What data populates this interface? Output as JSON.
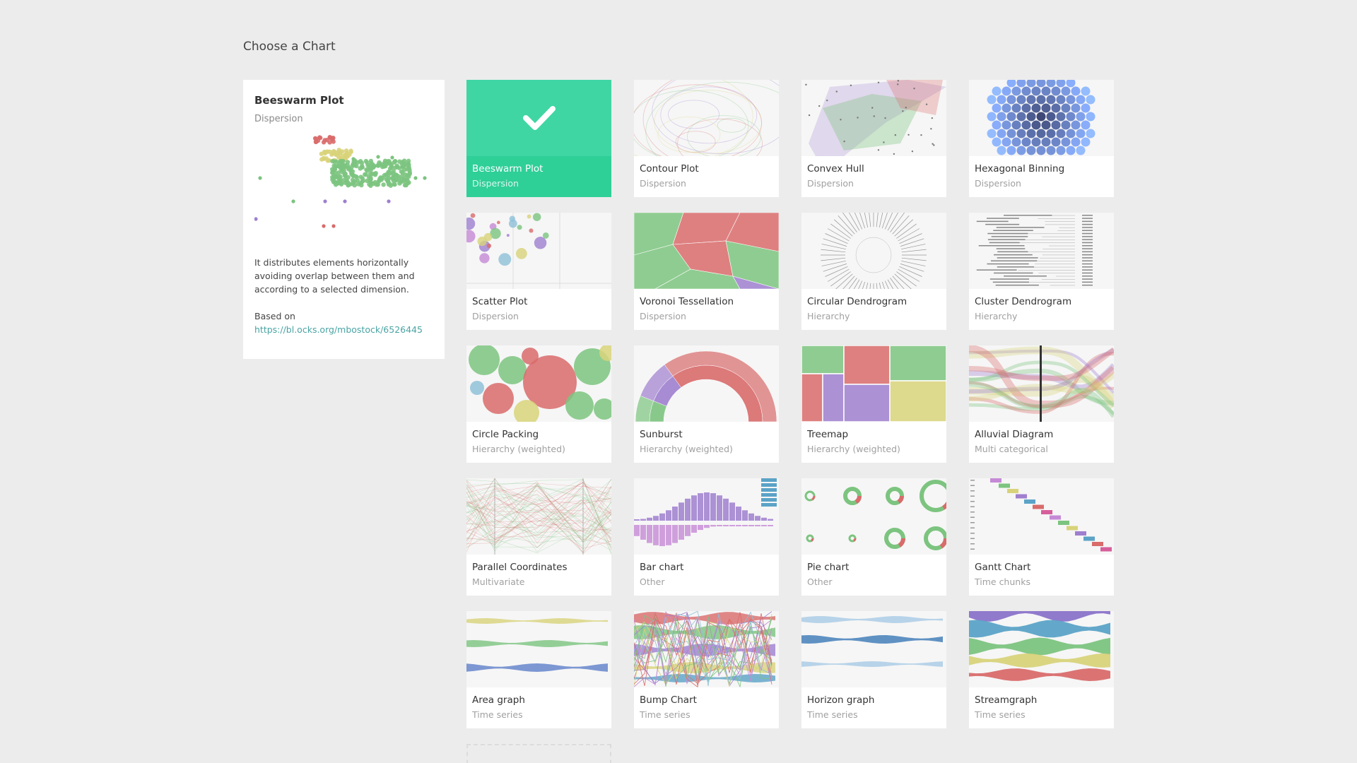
{
  "page": {
    "title": "Choose a Chart"
  },
  "colors": {
    "background": "#ececec",
    "selected": "#2fcf98",
    "link": "#4aa3a3",
    "green": "#7cc47f",
    "red": "#d96b6b",
    "purple": "#9f7fcf",
    "yellow": "#d8d37a",
    "blue": "#3b6fb6"
  },
  "details": {
    "title": "Beeswarm Plot",
    "category": "Dispersion",
    "description": "It distributes elements horizontally avoiding overlap between them and according to a selected dimension.",
    "based_on_label": "Based on",
    "based_on_link": "https://bl.ocks.org/mbostock/6526445"
  },
  "charts": [
    {
      "name": "Beeswarm Plot",
      "category": "Dispersion",
      "thumb": "beeswarm",
      "selected": true
    },
    {
      "name": "Contour Plot",
      "category": "Dispersion",
      "thumb": "contour",
      "selected": false
    },
    {
      "name": "Convex Hull",
      "category": "Dispersion",
      "thumb": "convex",
      "selected": false
    },
    {
      "name": "Hexagonal Binning",
      "category": "Dispersion",
      "thumb": "hexbin",
      "selected": false
    },
    {
      "name": "Scatter Plot",
      "category": "Dispersion",
      "thumb": "scatter",
      "selected": false
    },
    {
      "name": "Voronoi Tessellation",
      "category": "Dispersion",
      "thumb": "voronoi",
      "selected": false
    },
    {
      "name": "Circular Dendrogram",
      "category": "Hierarchy",
      "thumb": "circdendro",
      "selected": false
    },
    {
      "name": "Cluster Dendrogram",
      "category": "Hierarchy",
      "thumb": "clusterdendro",
      "selected": false
    },
    {
      "name": "Circle Packing",
      "category": "Hierarchy (weighted)",
      "thumb": "packing",
      "selected": false
    },
    {
      "name": "Sunburst",
      "category": "Hierarchy (weighted)",
      "thumb": "sunburst",
      "selected": false
    },
    {
      "name": "Treemap",
      "category": "Hierarchy (weighted)",
      "thumb": "treemap",
      "selected": false
    },
    {
      "name": "Alluvial Diagram",
      "category": "Multi categorical",
      "thumb": "alluvial",
      "selected": false
    },
    {
      "name": "Parallel Coordinates",
      "category": "Multivariate",
      "thumb": "parallel",
      "selected": false
    },
    {
      "name": "Bar chart",
      "category": "Other",
      "thumb": "bar",
      "selected": false
    },
    {
      "name": "Pie chart",
      "category": "Other",
      "thumb": "pie",
      "selected": false
    },
    {
      "name": "Gantt Chart",
      "category": "Time chunks",
      "thumb": "gantt",
      "selected": false
    },
    {
      "name": "Area graph",
      "category": "Time series",
      "thumb": "area",
      "selected": false
    },
    {
      "name": "Bump Chart",
      "category": "Time series",
      "thumb": "bump",
      "selected": false
    },
    {
      "name": "Horizon graph",
      "category": "Time series",
      "thumb": "horizon",
      "selected": false
    },
    {
      "name": "Streamgraph",
      "category": "Time series",
      "thumb": "stream",
      "selected": false
    }
  ]
}
